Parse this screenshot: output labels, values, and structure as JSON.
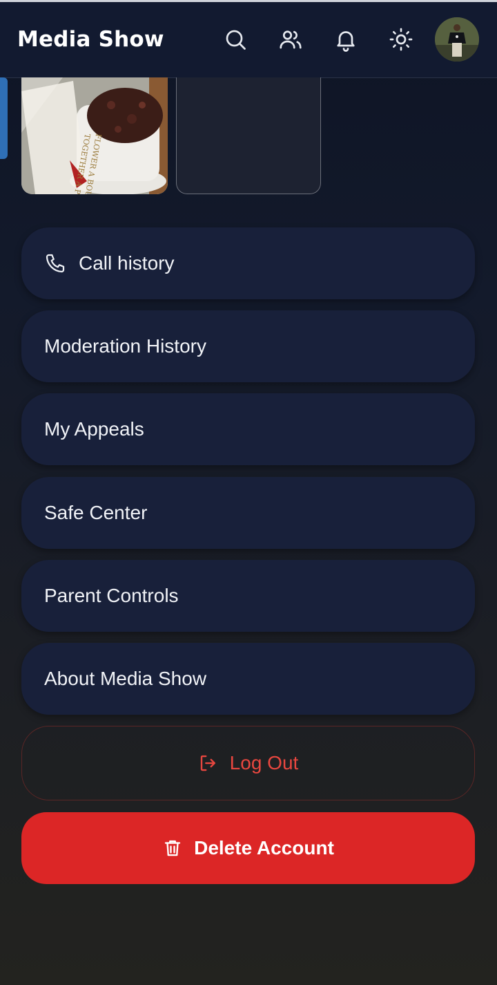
{
  "header": {
    "title": "Media Show",
    "icons": [
      "search-icon",
      "users-icon",
      "bell-icon",
      "sun-icon",
      "avatar"
    ]
  },
  "gallery": {
    "thumb1_caption_lines": [
      "TOGETHER A PERSON",
      "FLOWER A BOUQET"
    ]
  },
  "menu": {
    "items": [
      {
        "label": "Call history",
        "icon": "phone-icon"
      },
      {
        "label": "Moderation History"
      },
      {
        "label": "My Appeals"
      },
      {
        "label": "Safe Center"
      },
      {
        "label": "Parent Controls"
      },
      {
        "label": "About Media Show"
      }
    ]
  },
  "actions": {
    "logout_label": "Log Out",
    "delete_label": "Delete Account"
  },
  "colors": {
    "accent_red": "#dc2626",
    "logout_red": "#e8473f",
    "menu_bg": "#18203a",
    "header_bg": "#121a30"
  }
}
